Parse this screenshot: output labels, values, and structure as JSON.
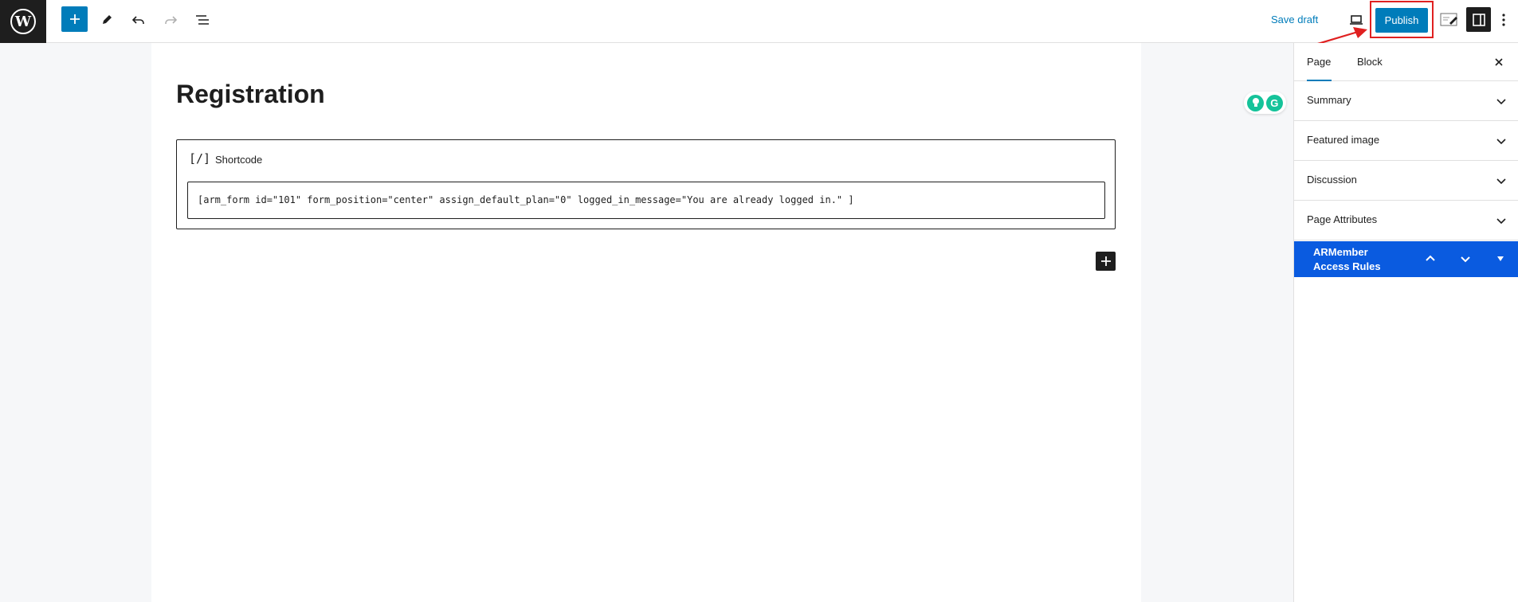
{
  "toolbar": {
    "logo": "wordpress-logo",
    "save_draft": "Save draft",
    "publish": "Publish"
  },
  "editor": {
    "title": "Registration",
    "block": {
      "icon": "[/]",
      "label": "Shortcode",
      "value": "[arm_form id=\"101\" form_position=\"center\" assign_default_plan=\"0\" logged_in_message=\"You are already logged in.\" ]"
    }
  },
  "sidebar": {
    "tabs": [
      "Page",
      "Block"
    ],
    "panels": [
      "Summary",
      "Featured image",
      "Discussion",
      "Page Attributes"
    ],
    "armember": {
      "line1": "ARMember",
      "line2": "Access Rules"
    }
  },
  "colors": {
    "accent": "#007cba",
    "armember": "#0a5be0",
    "annotation": "#e02020"
  }
}
